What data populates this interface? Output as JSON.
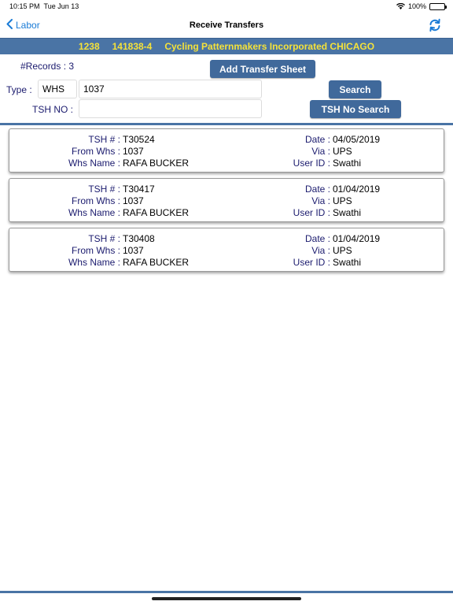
{
  "status_bar": {
    "time": "10:15 PM",
    "date": "Tue Jun 13",
    "battery": "100%",
    "battery_level": 1.0,
    "wifi_icon": "wifi-icon",
    "battery_icon": "battery-icon"
  },
  "nav": {
    "back_label": "Labor",
    "title": "Receive Transfers",
    "back_icon": "chevron-left-icon",
    "refresh_icon": "refresh-icon"
  },
  "banner": {
    "code1": "1238",
    "code2": "141838-4",
    "company": "Cycling Patternmakers Incorporated CHICAGO"
  },
  "form": {
    "records_label": "#Records : 3",
    "add_button": "Add Transfer Sheet",
    "type_label": "Type :",
    "type_value": "WHS",
    "whs_value": "1037",
    "search_button": "Search",
    "tsh_label": "TSH NO :",
    "tsh_value": "",
    "tsh_search_button": "TSH No Search"
  },
  "labels": {
    "tsh": "TSH # :",
    "from_whs": "From Whs :",
    "whs_name": "Whs Name :",
    "date": "Date :",
    "via": "Via :",
    "user_id": "User ID :"
  },
  "records": [
    {
      "tsh": "T30524",
      "from_whs": "1037",
      "whs_name": "RAFA BUCKER",
      "date": "04/05/2019",
      "via": "UPS",
      "user_id": "Swathi"
    },
    {
      "tsh": "T30417",
      "from_whs": "1037",
      "whs_name": "RAFA BUCKER",
      "date": "01/04/2019",
      "via": "UPS",
      "user_id": "Swathi"
    },
    {
      "tsh": "T30408",
      "from_whs": "1037",
      "whs_name": "RAFA BUCKER",
      "date": "01/04/2019",
      "via": "UPS",
      "user_id": "Swathi"
    }
  ],
  "colors": {
    "accent_blue": "#1a7bd6",
    "banner_bg": "#4a74a5",
    "banner_text": "#f5e23a",
    "button_bg": "#40699b",
    "label_text": "#1b1b6e"
  }
}
